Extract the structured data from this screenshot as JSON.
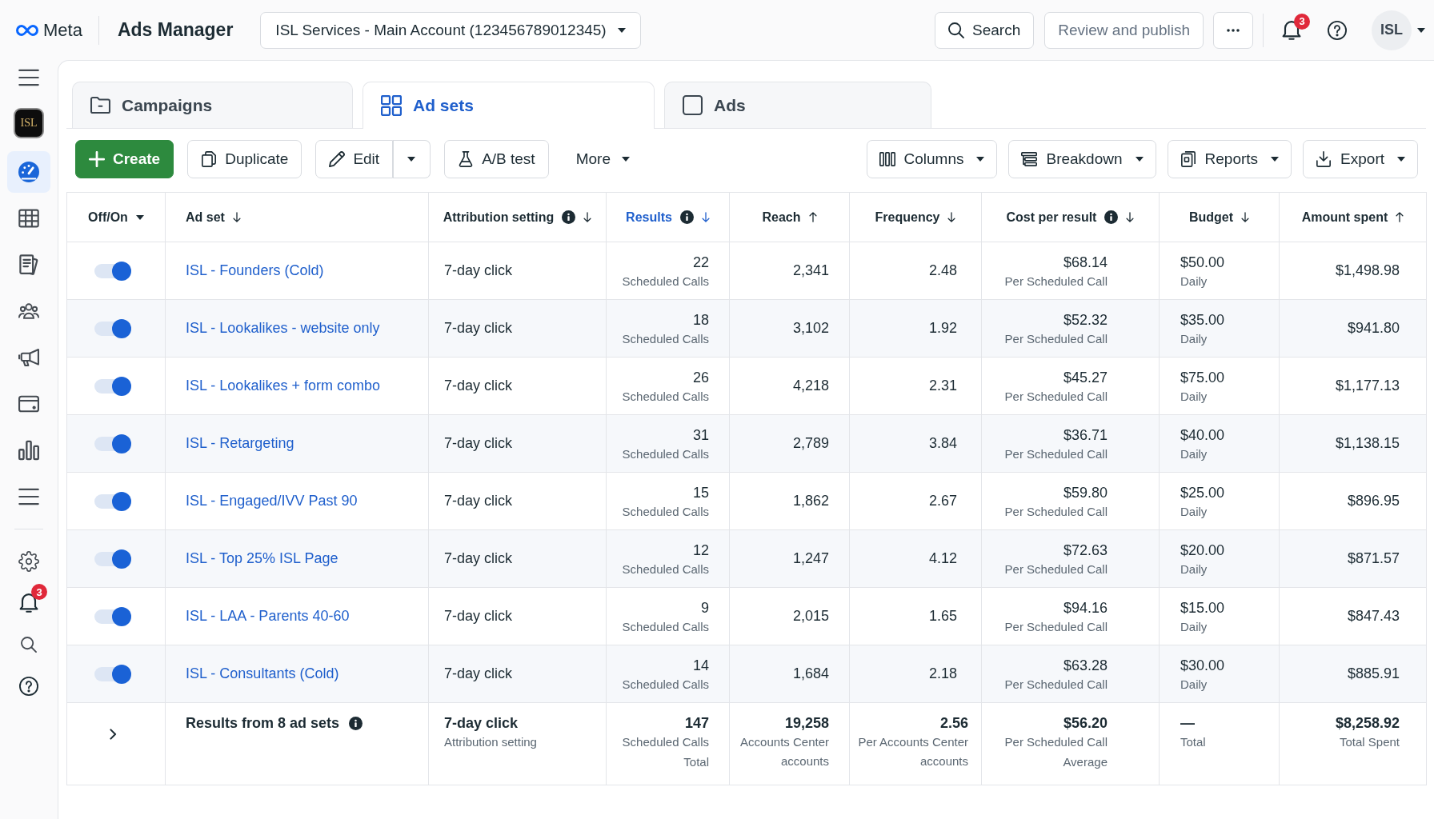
{
  "top_bar": {
    "brand": "Meta",
    "app_title": "Ads Manager",
    "account": "ISL Services - Main Account (123456789012345)",
    "search": "Search",
    "publish": {
      "label": "Review and publish",
      "disabled": true
    },
    "notification_count": "3",
    "avatar": "ISL"
  },
  "sidebar": {
    "account_logo": "ISL",
    "nav_items": [
      {
        "selected": true
      },
      {
        "selected": false
      },
      {
        "selected": false
      },
      {
        "selected": false
      },
      {
        "selected": false
      },
      {
        "selected": false
      },
      {
        "selected": false
      },
      {
        "selected": false
      }
    ],
    "notification_count": "3"
  },
  "tabs": [
    {
      "label": "Campaigns",
      "selected": false
    },
    {
      "label": "Ad sets",
      "selected": true
    },
    {
      "label": "Ads",
      "selected": false
    }
  ],
  "toolbar": {
    "left": [
      {
        "label": "Create",
        "kind": "primary"
      },
      {
        "label": "Duplicate",
        "kind": "default"
      },
      {
        "label": "Edit",
        "kind": "split"
      },
      {
        "label": "A/B test",
        "kind": "default"
      },
      {
        "label": "More",
        "kind": "menu"
      }
    ],
    "right": [
      {
        "label": "Columns",
        "kind": "dropdown"
      },
      {
        "label": "Breakdown",
        "kind": "dropdown"
      },
      {
        "label": "Reports",
        "kind": "dropdown"
      },
      {
        "label": "Export",
        "kind": "dropdown"
      }
    ]
  },
  "table": {
    "columns": [
      {
        "label": "Off/On",
        "info": false,
        "kind": "caret",
        "selected": false
      },
      {
        "label": "Ad set",
        "info": false,
        "kind": "descending",
        "selected": false
      },
      {
        "label": "Attribution setting",
        "info": true,
        "kind": "descending",
        "selected": false
      },
      {
        "label": "Results",
        "info": true,
        "kind": "descending",
        "selected": true
      },
      {
        "label": "Reach",
        "info": false,
        "kind": "ascending",
        "selected": false
      },
      {
        "label": "Frequency",
        "info": false,
        "kind": "descending",
        "selected": false
      },
      {
        "label": "Cost per result",
        "info": true,
        "kind": "descending",
        "selected": false
      },
      {
        "label": "Budget",
        "info": false,
        "kind": "descending",
        "selected": false
      },
      {
        "label": "Amount spent",
        "info": false,
        "kind": "ascending",
        "selected": false
      }
    ],
    "rows": [
      {
        "on": true,
        "name": "ISL - Founders (Cold)",
        "attribution": "7-day click",
        "results": "22",
        "results_label": "Scheduled Calls",
        "reach": "2,341",
        "frequency": "2.48",
        "cost": "$68.14",
        "cost_label": "Per Scheduled Call",
        "budget": "$50.00",
        "budget_label": "Daily",
        "amount_spent": "$1,498.98"
      },
      {
        "on": true,
        "name": "ISL - Lookalikes - website only",
        "attribution": "7-day click",
        "results": "18",
        "results_label": "Scheduled Calls",
        "reach": "3,102",
        "frequency": "1.92",
        "cost": "$52.32",
        "cost_label": "Per Scheduled Call",
        "budget": "$35.00",
        "budget_label": "Daily",
        "amount_spent": "$941.80"
      },
      {
        "on": true,
        "name": "ISL - Lookalikes + form combo",
        "attribution": "7-day click",
        "results": "26",
        "results_label": "Scheduled Calls",
        "reach": "4,218",
        "frequency": "2.31",
        "cost": "$45.27",
        "cost_label": "Per Scheduled Call",
        "budget": "$75.00",
        "budget_label": "Daily",
        "amount_spent": "$1,177.13"
      },
      {
        "on": true,
        "name": "ISL - Retargeting",
        "attribution": "7-day click",
        "results": "31",
        "results_label": "Scheduled Calls",
        "reach": "2,789",
        "frequency": "3.84",
        "cost": "$36.71",
        "cost_label": "Per Scheduled Call",
        "budget": "$40.00",
        "budget_label": "Daily",
        "amount_spent": "$1,138.15"
      },
      {
        "on": true,
        "name": "ISL - Engaged/IVV Past 90",
        "attribution": "7-day click",
        "results": "15",
        "results_label": "Scheduled Calls",
        "reach": "1,862",
        "frequency": "2.67",
        "cost": "$59.80",
        "cost_label": "Per Scheduled Call",
        "budget": "$25.00",
        "budget_label": "Daily",
        "amount_spent": "$896.95"
      },
      {
        "on": true,
        "name": "ISL - Top 25% ISL Page",
        "attribution": "7-day click",
        "results": "12",
        "results_label": "Scheduled Calls",
        "reach": "1,247",
        "frequency": "4.12",
        "cost": "$72.63",
        "cost_label": "Per Scheduled Call",
        "budget": "$20.00",
        "budget_label": "Daily",
        "amount_spent": "$871.57"
      },
      {
        "on": true,
        "name": "ISL - LAA - Parents 40-60",
        "attribution": "7-day click",
        "results": "9",
        "results_label": "Scheduled Calls",
        "reach": "2,015",
        "frequency": "1.65",
        "cost": "$94.16",
        "cost_label": "Per Scheduled Call",
        "budget": "$15.00",
        "budget_label": "Daily",
        "amount_spent": "$847.43"
      },
      {
        "on": true,
        "name": "ISL - Consultants (Cold)",
        "attribution": "7-day click",
        "results": "14",
        "results_label": "Scheduled Calls",
        "reach": "1,684",
        "frequency": "2.18",
        "cost": "$63.28",
        "cost_label": "Per Scheduled Call",
        "budget": "$30.00",
        "budget_label": "Daily",
        "amount_spent": "$885.91"
      }
    ],
    "summary": {
      "label": "Results from 8 ad sets",
      "info": true,
      "attribution": "7-day click",
      "attribution_label": "Attribution setting",
      "results": "147",
      "results_label": "Scheduled Calls",
      "results_note": "Total",
      "reach": "19,258",
      "reach_label": "Accounts Center accounts",
      "frequency": "2.56",
      "frequency_label": "Per Accounts Center accounts",
      "cost": "$56.20",
      "cost_label": "Per Scheduled Call",
      "cost_note": "Average",
      "budget": "—",
      "budget_label": "Total",
      "amount_spent": "$8,258.92",
      "amount_label": "Total Spent"
    }
  }
}
